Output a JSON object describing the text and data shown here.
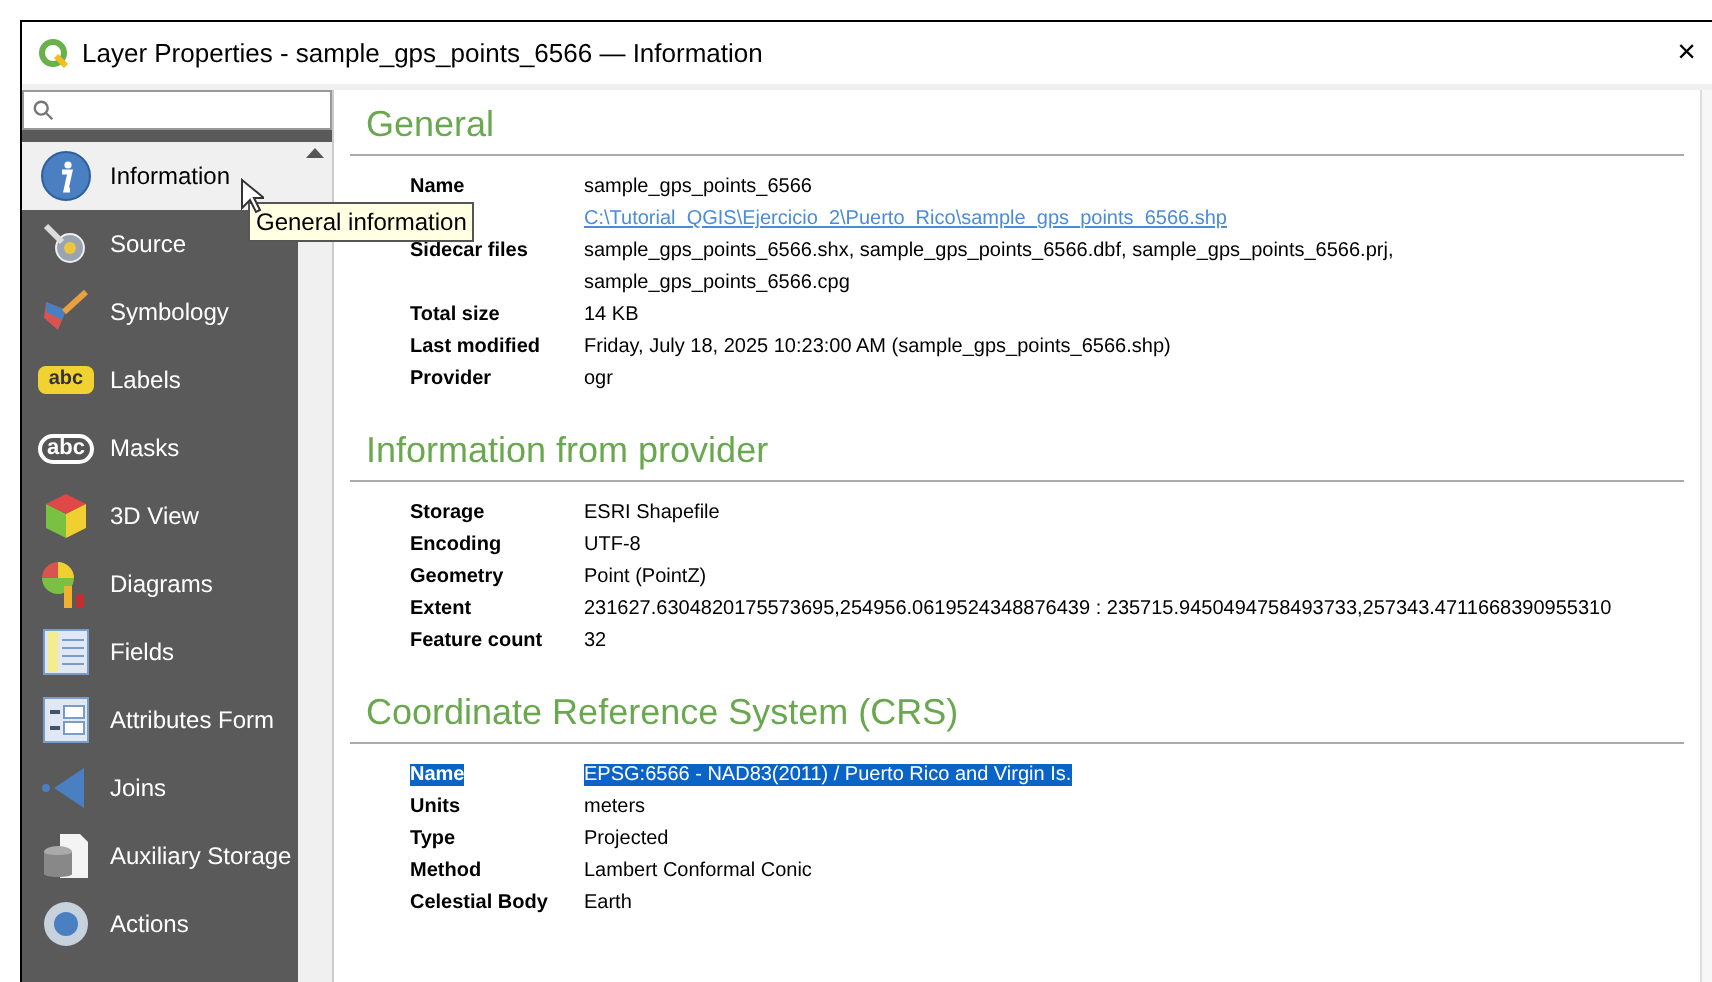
{
  "window": {
    "title": "Layer Properties - sample_gps_points_6566 — Information",
    "close": "×"
  },
  "sidebar": {
    "items": [
      {
        "label": "Information",
        "kind": "info",
        "selected": true
      },
      {
        "label": "Source",
        "kind": "source",
        "selected": false
      },
      {
        "label": "Symbology",
        "kind": "symbology",
        "selected": false
      },
      {
        "label": "Labels",
        "kind": "labels",
        "badge": "abc",
        "selected": false
      },
      {
        "label": "Masks",
        "kind": "masks",
        "badge": "abc",
        "selected": false
      },
      {
        "label": "3D View",
        "kind": "cube",
        "selected": false
      },
      {
        "label": "Diagrams",
        "kind": "diagrams",
        "selected": false
      },
      {
        "label": "Fields",
        "kind": "fields",
        "selected": false
      },
      {
        "label": "Attributes Form",
        "kind": "form",
        "selected": false
      },
      {
        "label": "Joins",
        "kind": "joins",
        "selected": false
      },
      {
        "label": "Auxiliary Storage",
        "kind": "storage",
        "selected": false
      },
      {
        "label": "Actions",
        "kind": "actions",
        "selected": false
      }
    ]
  },
  "tooltip": "General information",
  "sections": [
    {
      "title": "General",
      "rows": [
        {
          "label": "Name",
          "value": "sample_gps_points_6566",
          "kind": "text",
          "selected": false
        },
        {
          "value": "C:\\Tutorial_QGIS\\Ejercicio_2\\Puerto_Rico\\sample_gps_points_6566.shp",
          "kind": "link",
          "selected": false
        },
        {
          "label": "Sidecar files",
          "value": "sample_gps_points_6566.shx, sample_gps_points_6566.dbf, sample_gps_points_6566.prj, sample_gps_points_6566.cpg",
          "kind": "text",
          "selected": false
        },
        {
          "label": "Total size",
          "value": "14 KB",
          "kind": "text",
          "selected": false
        },
        {
          "label": "Last modified",
          "value": "Friday, July 18, 2025 10:23:00 AM (sample_gps_points_6566.shp)",
          "kind": "text",
          "selected": false
        },
        {
          "label": "Provider",
          "value": "ogr",
          "kind": "text",
          "selected": false
        }
      ]
    },
    {
      "title": "Information from provider",
      "rows": [
        {
          "label": "Storage",
          "value": "ESRI Shapefile",
          "kind": "text",
          "selected": false
        },
        {
          "label": "Encoding",
          "value": "UTF-8",
          "kind": "text",
          "selected": false
        },
        {
          "label": "Geometry",
          "value": "Point (PointZ)",
          "kind": "text",
          "selected": false
        },
        {
          "label": "Extent",
          "value": "231627.6304820175573695,254956.0619524348876439 : 235715.9450494758493733,257343.4711668390955310",
          "kind": "text",
          "selected": false
        },
        {
          "label": "Feature count",
          "value": "32",
          "kind": "text",
          "selected": false
        }
      ]
    },
    {
      "title": "Coordinate Reference System (CRS)",
      "rows": [
        {
          "label": "Name",
          "value": "EPSG:6566 - NAD83(2011) / Puerto Rico and Virgin Is.",
          "kind": "text",
          "selected": true
        },
        {
          "label": "Units",
          "value": "meters",
          "kind": "text",
          "selected": false
        },
        {
          "label": "Type",
          "value": "Projected",
          "kind": "text",
          "selected": false
        },
        {
          "label": "Method",
          "value": "Lambert Conformal Conic",
          "kind": "text",
          "selected": false
        },
        {
          "label": "Celestial Body",
          "value": "Earth",
          "kind": "text",
          "selected": false
        }
      ]
    }
  ]
}
